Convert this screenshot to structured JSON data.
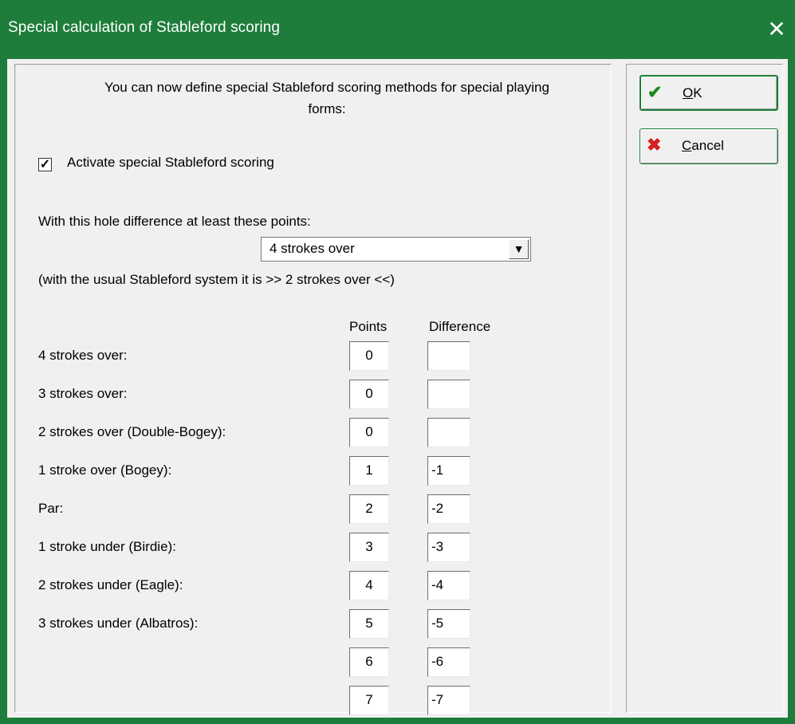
{
  "window": {
    "title": "Special calculation of Stableford scoring",
    "close_glyph": "✕"
  },
  "intro_text": "You can now define special Stableford scoring methods for special playing forms:",
  "activate": {
    "label": "Activate special Stableford scoring",
    "checked": true,
    "check_glyph": "✓"
  },
  "hole_difference_label": "With this hole difference at least these points:",
  "dropdown": {
    "value": "4 strokes over",
    "arrow": "▼"
  },
  "usual_note": "(with the usual Stableford system it is >> 2 strokes over <<)",
  "headers": {
    "points": "Points",
    "difference": "Difference"
  },
  "rows": [
    {
      "label": "4 strokes over:",
      "points": "0",
      "difference": ""
    },
    {
      "label": "3 strokes over:",
      "points": "0",
      "difference": ""
    },
    {
      "label": "2 strokes over (Double-Bogey):",
      "points": "0",
      "difference": ""
    },
    {
      "label": "1 stroke over (Bogey):",
      "points": "1",
      "difference": "-1"
    },
    {
      "label": "Par:",
      "points": "2",
      "difference": "-2"
    },
    {
      "label": "1 stroke under (Birdie):",
      "points": "3",
      "difference": "-3"
    },
    {
      "label": "2 strokes under (Eagle):",
      "points": "4",
      "difference": "-4"
    },
    {
      "label": "3 strokes under (Albatros):",
      "points": "5",
      "difference": "-5"
    },
    {
      "label": "",
      "points": "6",
      "difference": "-6"
    },
    {
      "label": "",
      "points": "7",
      "difference": "-7"
    }
  ],
  "buttons": {
    "ok": {
      "mnemonic": "O",
      "rest": "K",
      "icon": "✔"
    },
    "cancel": {
      "mnemonic": "C",
      "rest": "ancel",
      "icon": "✖"
    }
  },
  "colors": {
    "titlebar": "#1e7d3a",
    "ok_icon": "#1a8a1a",
    "cancel_icon": "#d42020"
  }
}
